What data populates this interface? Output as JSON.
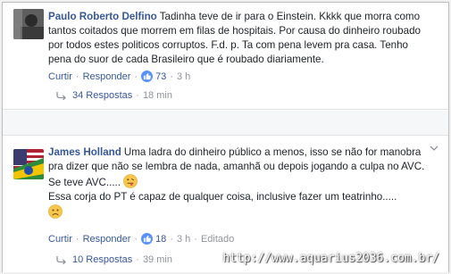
{
  "comments": [
    {
      "author": "Paulo Roberto Delfino",
      "text": "Tadinha teve de ir para o Einstein. Kkkk que morra como tantos coitados que morrem em filas de hospitais. Por causa do dinheiro roubado por todos estes politicos corruptos. F.d. p. Ta com pena levem pra casa. Tenho pena do suor de cada Brasileiro que é roubado diariamente.",
      "like_label": "Curtir",
      "reply_label": "Responder",
      "like_count": "73",
      "time": "3 h",
      "replies_label": "34 Respostas",
      "replies_time": "18 min"
    },
    {
      "author": "James Holland",
      "line1": "Uma ladra do dinheiro público a menos, isso se não for manobra pra dizer que não se lembra de nada, amanhã ou depois jogando a culpa no AVC.",
      "line2": "Se teve AVC.....",
      "line3": "Essa corja do PT é capaz de qualquer coisa, inclusive fazer um teatrinho.....",
      "like_label": "Curtir",
      "reply_label": "Responder",
      "like_count": "18",
      "time": "3 h",
      "edited_label": "Editado",
      "replies_label": "10 Respostas",
      "replies_time": "39 min"
    }
  ],
  "watermark": "http://www.aquarius2036.com.br/",
  "colors": {
    "link": "#365899",
    "meta": "#90949c",
    "like": "#5890ff"
  },
  "icons": [
    "like-icon",
    "reply-arrow-icon",
    "chevron-down-icon",
    "tongue-emoji-icon",
    "frown-emoji-icon"
  ]
}
